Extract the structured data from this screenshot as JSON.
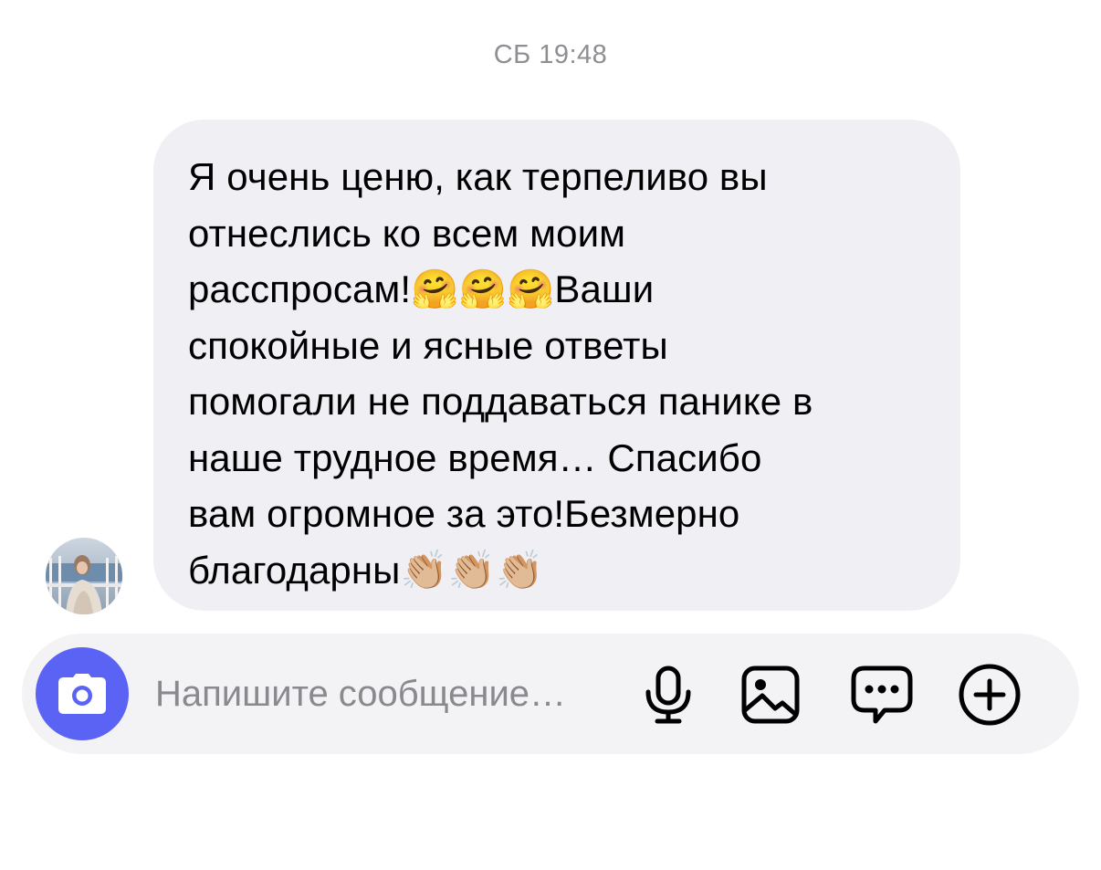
{
  "thread": {
    "timestamp": "СБ 19:48"
  },
  "message": {
    "text": "Я очень ценю, как терпеливо вы\nотнеслись ко всем моим\nрасспросам!🤗🤗🤗Ваши\nспокойные и ясные ответы\nпомогали не поддаваться панике в\nнаше трудное время… Спасибо\nвам огромное за это!Безмерно\nблагодарны👏🏼👏🏼👏🏼"
  },
  "composer": {
    "placeholder": "Напишите сообщение…",
    "value": "",
    "accent_color": "#5b63f5",
    "icons": [
      "camera-icon",
      "microphone-icon",
      "image-icon",
      "chat-bubble-icon",
      "plus-circle-icon"
    ]
  },
  "colors": {
    "bubble_background": "#efeff4",
    "composer_background": "#f3f3f6",
    "timestamp_text": "#8e8e93",
    "placeholder_text": "#8a8a8e"
  }
}
